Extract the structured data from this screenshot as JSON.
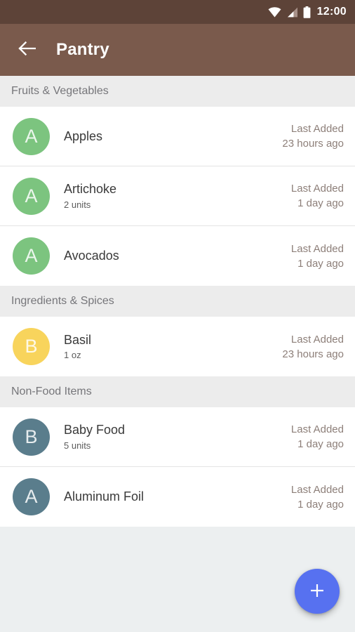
{
  "status_bar": {
    "time": "12:00",
    "icons": [
      "wifi-icon",
      "signal-icon",
      "battery-icon"
    ],
    "background": "#5d4338"
  },
  "app_bar": {
    "back_label": "back-arrow",
    "title": "Pantry",
    "background": "#7a5a4c"
  },
  "colors": {
    "avatar_green": "#7cc47f",
    "avatar_yellow": "#f8d45c",
    "avatar_bluegray": "#5a7d8c",
    "fab": "#5771f0",
    "meta_text": "#8d7f79",
    "section_bg": "#ececec"
  },
  "sections": [
    {
      "title": "Fruits & Vegetables",
      "items": [
        {
          "initial": "A",
          "avatar_color": "#7cc47f",
          "title": "Apples",
          "subtitle": "",
          "meta_label": "Last Added",
          "meta_value": "23 hours ago"
        },
        {
          "initial": "A",
          "avatar_color": "#7cc47f",
          "title": "Artichoke",
          "subtitle": "2 units",
          "meta_label": "Last Added",
          "meta_value": "1 day ago"
        },
        {
          "initial": "A",
          "avatar_color": "#7cc47f",
          "title": "Avocados",
          "subtitle": "",
          "meta_label": "Last Added",
          "meta_value": "1 day ago"
        }
      ]
    },
    {
      "title": "Ingredients & Spices",
      "items": [
        {
          "initial": "B",
          "avatar_color": "#f8d45c",
          "title": "Basil",
          "subtitle": "1 oz",
          "meta_label": "Last Added",
          "meta_value": "23 hours ago"
        }
      ]
    },
    {
      "title": "Non-Food Items",
      "items": [
        {
          "initial": "B",
          "avatar_color": "#5a7d8c",
          "title": "Baby Food",
          "subtitle": "5 units",
          "meta_label": "Last Added",
          "meta_value": "1 day ago"
        },
        {
          "initial": "A",
          "avatar_color": "#5a7d8c",
          "title": "Aluminum Foil",
          "subtitle": "",
          "meta_label": "Last Added",
          "meta_value": "1 day ago"
        }
      ]
    }
  ],
  "fab": {
    "icon": "plus-icon",
    "label": "+"
  }
}
